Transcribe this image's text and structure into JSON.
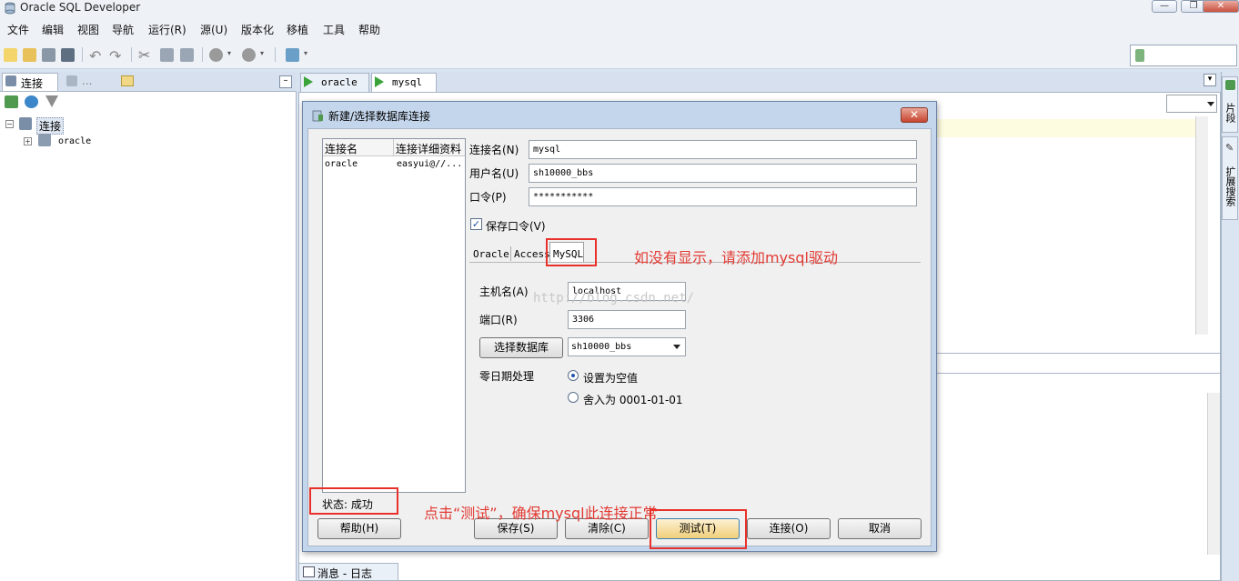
{
  "app": {
    "title": "Oracle SQL Developer"
  },
  "menu": [
    "文件",
    "编辑",
    "视图",
    "导航",
    "运行(R)",
    "源(U)",
    "版本化",
    "移植",
    "工具",
    "帮助"
  ],
  "left_panel": {
    "tabs": [
      {
        "label": "连接"
      },
      {
        "label": "..."
      }
    ],
    "tree": {
      "root": "连接",
      "child": "oracle"
    }
  },
  "editor": {
    "tabs": [
      {
        "label": "oracle"
      },
      {
        "label": "mysql"
      }
    ]
  },
  "right_strip": {
    "items": [
      "片段",
      "扩展搜索"
    ]
  },
  "bottom": {
    "log_tab": "消息 - 日志"
  },
  "dialog": {
    "title": "新建/选择数据库连接",
    "close": "✕",
    "list": {
      "headers": [
        "连接名",
        "连接详细资料"
      ],
      "rows": [
        {
          "name": "oracle",
          "details": "easyui@//..."
        }
      ]
    },
    "form": {
      "conn_name_label": "连接名(N)",
      "conn_name_value": "mysql",
      "user_label": "用户名(U)",
      "user_value": "sh10000_bbs",
      "password_label": "口令(P)",
      "password_value": "***********",
      "save_password_label": "保存口令(V)",
      "save_password_checked": true
    },
    "db_tabs": [
      "Oracle",
      "Access",
      "MySQL"
    ],
    "mysql": {
      "host_label": "主机名(A)",
      "host_value": "localhost",
      "port_label": "端口(R)",
      "port_value": "3306",
      "choose_db_button": "选择数据库",
      "db_value": "sh10000_bbs",
      "zero_date_label": "零日期处理",
      "zero_date_options": [
        "设置为空值",
        "舍入为 0001-01-01"
      ],
      "zero_date_selected": 0
    },
    "status": "状态: 成功",
    "buttons": {
      "help": "帮助(H)",
      "save": "保存(S)",
      "clear": "清除(C)",
      "test": "测试(T)",
      "connect": "连接(O)",
      "cancel": "取消"
    }
  },
  "annotations": {
    "mysql_hint": "如没有显示，请添加mysql驱动",
    "test_hint": "点击“测试”，确保mysql此连接正常"
  },
  "watermark": "http://blog.csdn.net/",
  "colors": {
    "annotation_red": "#e8312b",
    "dialog_frame": "#c4d6ec"
  }
}
